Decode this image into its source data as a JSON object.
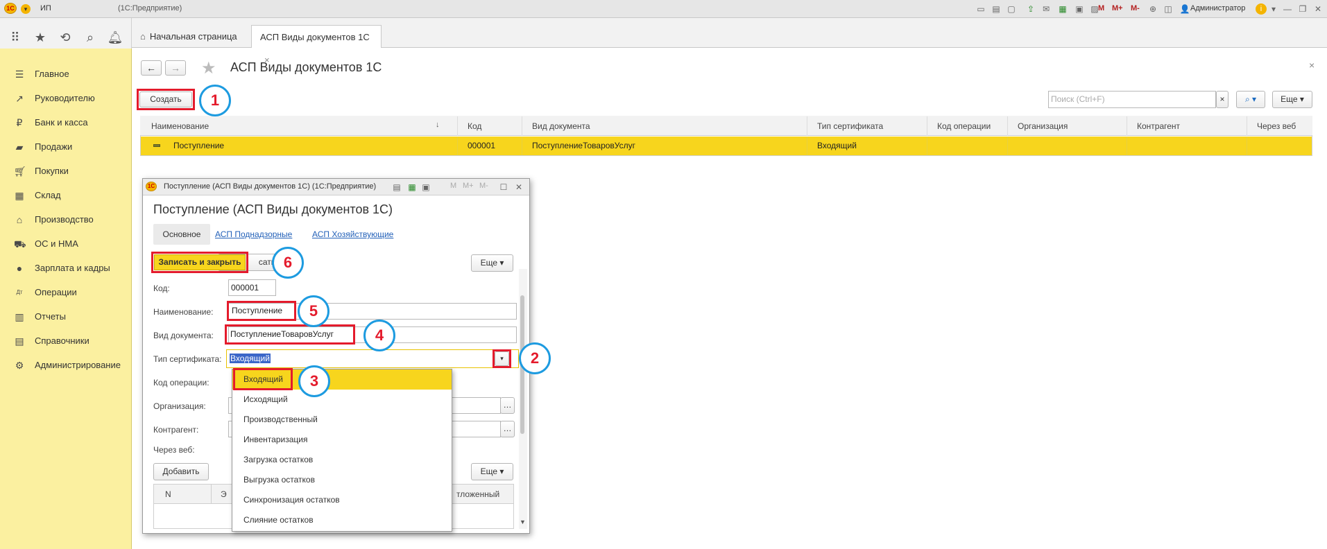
{
  "titlebar": {
    "app_prefix": "ИП",
    "app_name": "(1С:Предприятие)",
    "user": "Администратор",
    "m_label": "M",
    "mplus_label": "M+",
    "mminus_label": "M-"
  },
  "tabs": [
    {
      "label": "Начальная страница"
    },
    {
      "label": "АСП Виды документов 1С"
    }
  ],
  "sidebar": {
    "items": [
      {
        "label": "Главное",
        "icon": "menu-icon"
      },
      {
        "label": "Руководителю",
        "icon": "trend-icon"
      },
      {
        "label": "Банк и касса",
        "icon": "coin-icon"
      },
      {
        "label": "Продажи",
        "icon": "bag-icon"
      },
      {
        "label": "Покупки",
        "icon": "cart-icon"
      },
      {
        "label": "Склад",
        "icon": "warehouse-icon"
      },
      {
        "label": "Производство",
        "icon": "factory-icon"
      },
      {
        "label": "ОС и НМА",
        "icon": "truck-icon"
      },
      {
        "label": "Зарплата и кадры",
        "icon": "person-icon"
      },
      {
        "label": "Операции",
        "icon": "dtkt-icon"
      },
      {
        "label": "Отчеты",
        "icon": "report-icon"
      },
      {
        "label": "Справочники",
        "icon": "books-icon"
      },
      {
        "label": "Администрирование",
        "icon": "gear-icon"
      }
    ]
  },
  "page": {
    "title": "АСП Виды документов 1С",
    "create_label": "Создать",
    "search_placeholder": "Поиск (Ctrl+F)",
    "more_label": "Еще",
    "columns": [
      "Наименование",
      "Код",
      "Вид документа",
      "Тип сертификата",
      "Код операции",
      "Организация",
      "Контрагент",
      "Через веб"
    ],
    "row": {
      "name": "Поступление",
      "code": "000001",
      "doc_kind": "ПоступлениеТоваровУслуг",
      "cert_type": "Входящий"
    }
  },
  "dialog": {
    "window_title": "Поступление (АСП Виды документов 1С)  (1С:Предприятие)",
    "heading": "Поступление (АСП Виды документов 1С)",
    "tabs": [
      "Основное",
      "АСП Поднадзорные",
      "АСП Хозяйствующие"
    ],
    "save_close_label": "Записать и закрыть",
    "write_label_partial": "сать",
    "more_label": "Еще",
    "fields": {
      "code_label": "Код:",
      "code_value": "000001",
      "name_label": "Наименование:",
      "name_value": "Поступление",
      "doc_label": "Вид документа:",
      "doc_value": "ПоступлениеТоваровУслуг",
      "cert_label": "Тип сертификата:",
      "cert_value": "Входящий",
      "opcode_label": "Код операции:",
      "org_label": "Организация:",
      "contr_label": "Контрагент:",
      "web_label": "Через веб:"
    },
    "add_label": "Добавить",
    "table_col_n": "N",
    "table_col_e": "Э",
    "table_col_deferred": "тложенный",
    "dropdown": [
      "Входящий",
      "Исходящий",
      "Производственный",
      "Инвентаризация",
      "Загрузка остатков",
      "Выгрузка остатков",
      "Синхронизация остатков",
      "Слияние остатков"
    ]
  },
  "callouts": [
    "1",
    "2",
    "3",
    "4",
    "5",
    "6"
  ],
  "colors": {
    "accent_yellow": "#f7d51d",
    "sidebar_bg": "#fbf0a0",
    "callout_red": "#e41b2c",
    "callout_blue": "#1d9be0"
  }
}
